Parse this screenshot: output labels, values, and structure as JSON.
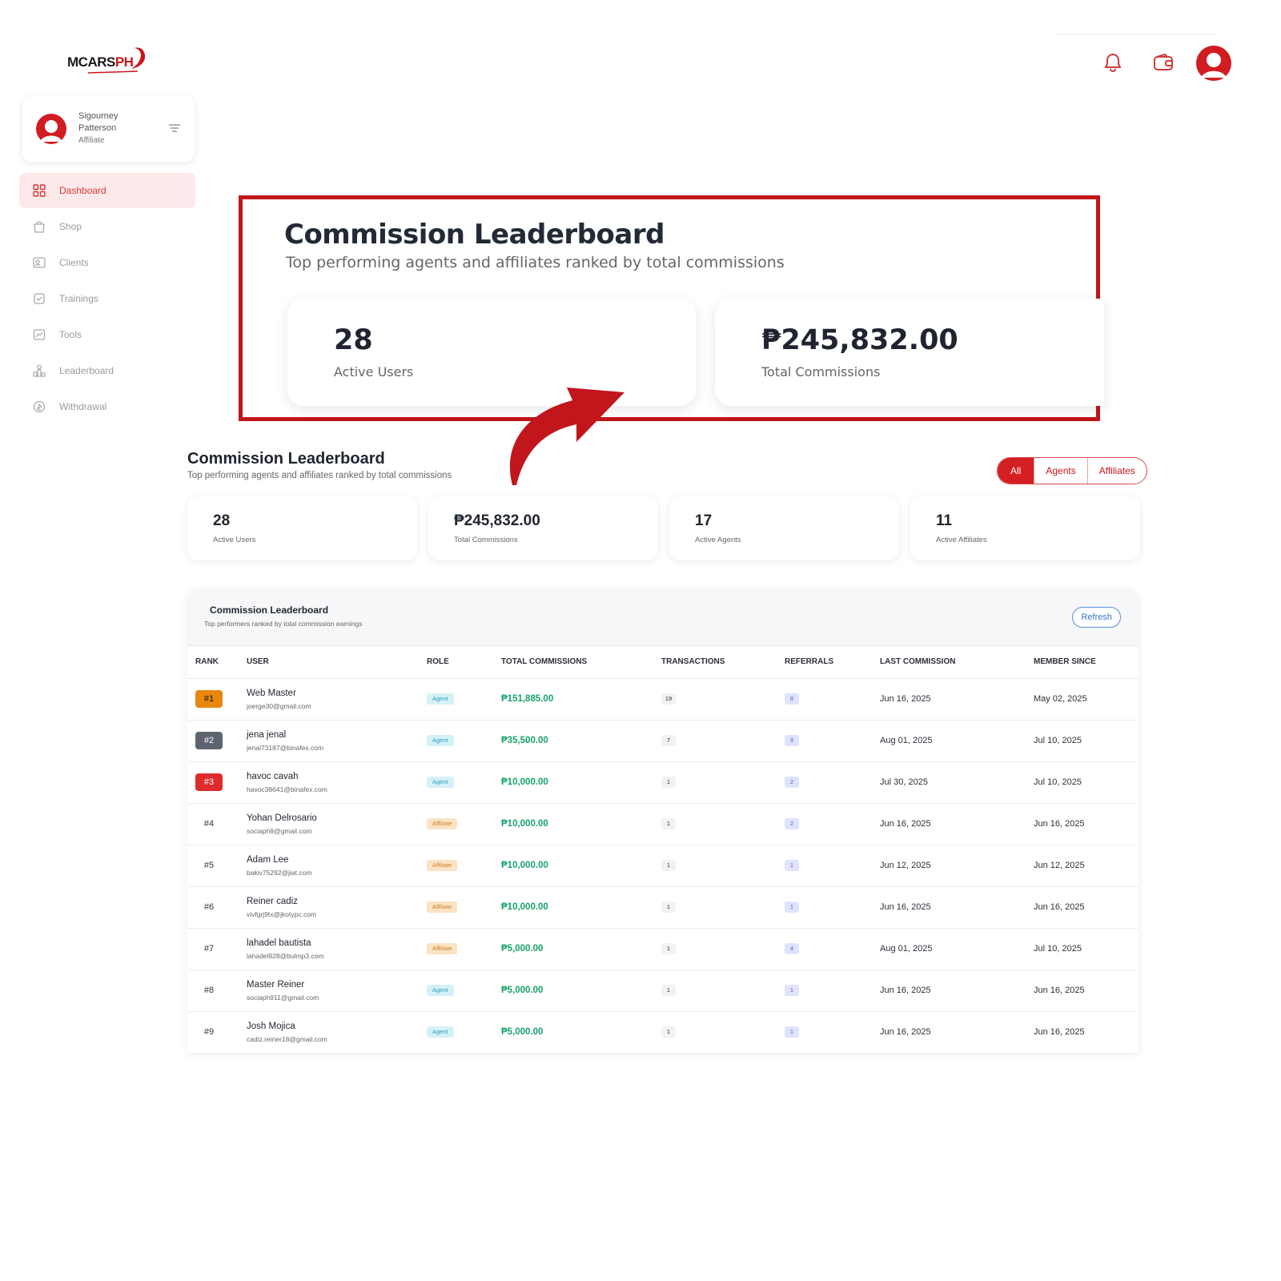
{
  "brand": {
    "logo_text_main": "MCARS",
    "logo_text_accent": "PH"
  },
  "user": {
    "name_line1": "Sigourney",
    "name_line2": "Patterson",
    "role": "Affiliate"
  },
  "sidebar": {
    "items": [
      {
        "label": "Dashboard",
        "icon": "dashboard-icon",
        "active": true
      },
      {
        "label": "Shop",
        "icon": "shop-icon",
        "active": false
      },
      {
        "label": "Clients",
        "icon": "clients-icon",
        "active": false
      },
      {
        "label": "Trainings",
        "icon": "trainings-icon",
        "active": false
      },
      {
        "label": "Tools",
        "icon": "tools-icon",
        "active": false
      },
      {
        "label": "Leaderboard",
        "icon": "leaderboard-icon",
        "active": false
      },
      {
        "label": "Withdrawal",
        "icon": "withdrawal-icon",
        "active": false
      }
    ]
  },
  "topbar": {
    "icons": [
      "bell-icon",
      "wallet-icon",
      "profile-avatar"
    ]
  },
  "callout": {
    "title": "Commission Leaderboard",
    "subtitle": "Top performing agents and affiliates ranked by total commissions",
    "cards": [
      {
        "value": "28",
        "label": "Active Users"
      },
      {
        "value": "₱245,832.00",
        "label": "Total Commissions"
      }
    ]
  },
  "page": {
    "title": "Commission Leaderboard",
    "subtitle": "Top performing agents and affiliates ranked by total commissions"
  },
  "filters": {
    "options": [
      "All",
      "Agents",
      "Affiliates"
    ],
    "selected": "All"
  },
  "stats": [
    {
      "value": "28",
      "label": "Active Users"
    },
    {
      "value": "₱245,832.00",
      "label": "Total Commissions"
    },
    {
      "value": "17",
      "label": "Active Agents"
    },
    {
      "value": "11",
      "label": "Active Affiliates"
    }
  ],
  "table": {
    "title": "Commission Leaderboard",
    "subtitle": "Top performers ranked by total commission earnings",
    "refresh_label": "Refresh",
    "columns": [
      "RANK",
      "USER",
      "ROLE",
      "TOTAL COMMISSIONS",
      "TRANSACTIONS",
      "REFERRALS",
      "LAST COMMISSION",
      "MEMBER SINCE"
    ],
    "rows": [
      {
        "rank": "#1",
        "name": "Web Master",
        "email": "joerge30@gmail.com",
        "role": "Agent",
        "total": "₱151,885.00",
        "transactions": "19",
        "referrals": "8",
        "last": "Jun 16, 2025",
        "since": "May 02, 2025"
      },
      {
        "rank": "#2",
        "name": "jena jenal",
        "email": "jenal73187@binafex.com",
        "role": "Agent",
        "total": "₱35,500.00",
        "transactions": "7",
        "referrals": "9",
        "last": "Aug 01, 2025",
        "since": "Jul 10, 2025"
      },
      {
        "rank": "#3",
        "name": "havoc cavah",
        "email": "havoc38641@binafex.com",
        "role": "Agent",
        "total": "₱10,000.00",
        "transactions": "1",
        "referrals": "2",
        "last": "Jul 30, 2025",
        "since": "Jul 10, 2025"
      },
      {
        "rank": "#4",
        "name": "Yohan Delrosario",
        "email": "sociaph9@gmail.com",
        "role": "Affiliate",
        "total": "₱10,000.00",
        "transactions": "1",
        "referrals": "2",
        "last": "Jun 16, 2025",
        "since": "Jun 16, 2025"
      },
      {
        "rank": "#5",
        "name": "Adam Lee",
        "email": "bakiv75292@jiat.com",
        "role": "Affiliate",
        "total": "₱10,000.00",
        "transactions": "1",
        "referrals": "1",
        "last": "Jun 12, 2025",
        "since": "Jun 12, 2025"
      },
      {
        "rank": "#6",
        "name": "Reiner cadiz",
        "email": "vivfgrj9tx@jkotypc.com",
        "role": "Affiliate",
        "total": "₱10,000.00",
        "transactions": "1",
        "referrals": "1",
        "last": "Jun 16, 2025",
        "since": "Jun 16, 2025"
      },
      {
        "rank": "#7",
        "name": "lahadel bautista",
        "email": "lahadel928@bulmp3.com",
        "role": "Affiliate",
        "total": "₱5,000.00",
        "transactions": "1",
        "referrals": "4",
        "last": "Aug 01, 2025",
        "since": "Jul 10, 2025"
      },
      {
        "rank": "#8",
        "name": "Master Reiner",
        "email": "sociaph911@gmail.com",
        "role": "Agent",
        "total": "₱5,000.00",
        "transactions": "1",
        "referrals": "1",
        "last": "Jun 16, 2025",
        "since": "Jun 16, 2025"
      },
      {
        "rank": "#9",
        "name": "Josh Mojica",
        "email": "cadiz.reiner18@gmail.com",
        "role": "Agent",
        "total": "₱5,000.00",
        "transactions": "1",
        "referrals": "1",
        "last": "Jun 16, 2025",
        "since": "Jun 16, 2025"
      }
    ]
  },
  "colors": {
    "brand_red": "#c8161d",
    "active_nav_bg": "#fde9e9",
    "amount_green": "#17a36a",
    "callout_border": "#c0161c"
  }
}
